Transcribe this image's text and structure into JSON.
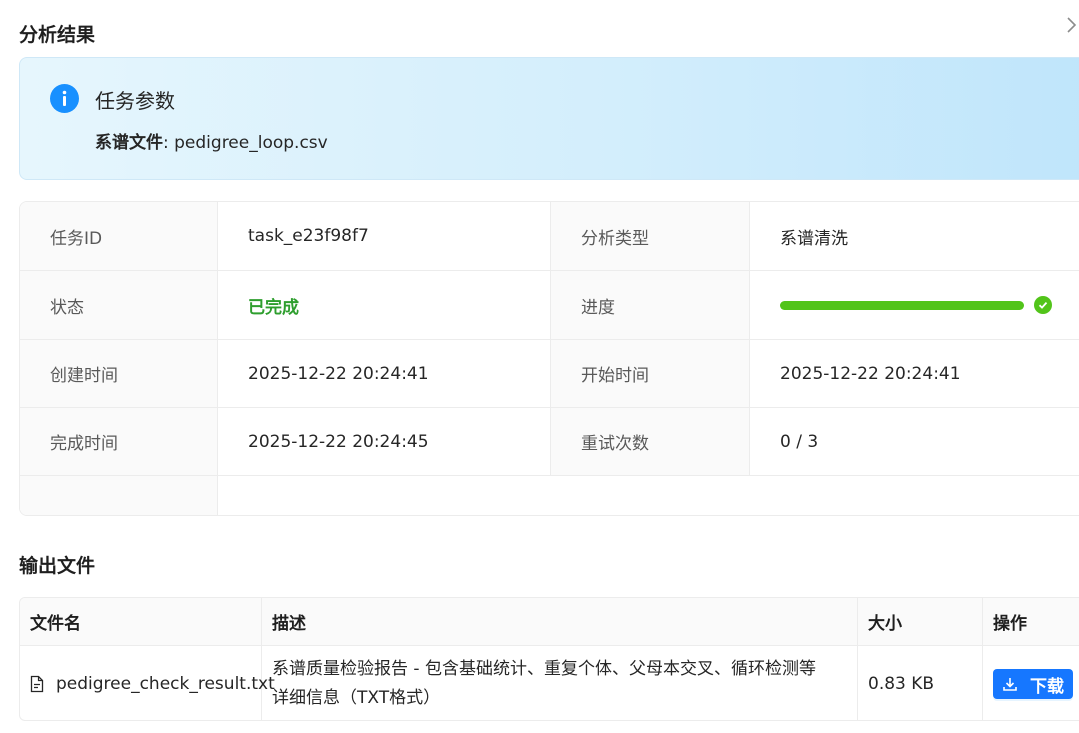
{
  "header": {
    "title": "分析结果"
  },
  "alert": {
    "title": "任务参数",
    "param_label": "系谱文件",
    "param_value": "pedigree_loop.csv",
    "info_color": "#1890ff"
  },
  "details": {
    "task_id_label": "任务ID",
    "task_id_value": "task_e23f98f7",
    "type_label": "分析类型",
    "type_value": "系谱清洗",
    "status_label": "状态",
    "status_value": "已完成",
    "progress_label": "进度",
    "progress_percent": 100,
    "created_label": "创建时间",
    "created_value": "2025-12-22 20:24:41",
    "started_label": "开始时间",
    "started_value": "2025-12-22 20:24:41",
    "finished_label": "完成时间",
    "finished_value": "2025-12-22 20:24:45",
    "retry_label": "重试次数",
    "retry_value": "0 / 3",
    "success_color": "#52c41a"
  },
  "output": {
    "title": "输出文件",
    "columns": {
      "name": "文件名",
      "desc": "描述",
      "size": "大小",
      "action": "操作"
    },
    "files": [
      {
        "name": "pedigree_check_result.txt",
        "desc_line1": "系谱质量检验报告 - 包含基础统计、重复个体、父母本交叉、循环检测等",
        "desc_line2": "详细信息（TXT格式）",
        "size": "0.83 KB",
        "action_label": "下载"
      }
    ],
    "button_color": "#1677ff"
  }
}
